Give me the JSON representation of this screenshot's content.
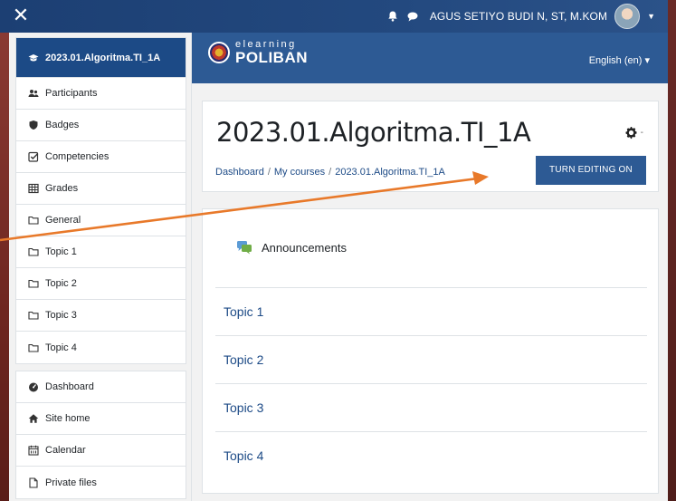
{
  "navbar": {
    "close_glyph": "✕",
    "user_name": "AGUS SETIYO BUDI N, ST, M.KOM",
    "icons": [
      "bell-icon",
      "chat-icon",
      "avatar",
      "caret-down-icon"
    ]
  },
  "header": {
    "logo_top": "elearning",
    "logo_bottom": "POLIBAN",
    "language": "English (en) ▾"
  },
  "sidebar": {
    "course_items": [
      {
        "label": "2023.01.Algoritma.TI_1A",
        "icon": "graduation-cap-icon",
        "active": true
      },
      {
        "label": "Participants",
        "icon": "users-icon"
      },
      {
        "label": "Badges",
        "icon": "shield-icon"
      },
      {
        "label": "Competencies",
        "icon": "check-square-icon"
      },
      {
        "label": "Grades",
        "icon": "table-icon"
      },
      {
        "label": "General",
        "icon": "folder-icon"
      },
      {
        "label": "Topic 1",
        "icon": "folder-icon"
      },
      {
        "label": "Topic 2",
        "icon": "folder-icon"
      },
      {
        "label": "Topic 3",
        "icon": "folder-icon"
      },
      {
        "label": "Topic 4",
        "icon": "folder-icon"
      }
    ],
    "site_items": [
      {
        "label": "Dashboard",
        "icon": "dashboard-icon"
      },
      {
        "label": "Site home",
        "icon": "home-icon"
      },
      {
        "label": "Calendar",
        "icon": "calendar-icon"
      },
      {
        "label": "Private files",
        "icon": "file-icon"
      }
    ]
  },
  "page": {
    "course_title": "2023.01.Algoritma.TI_1A",
    "breadcrumb": [
      "Dashboard",
      "My courses",
      "2023.01.Algoritma.TI_1A"
    ],
    "breadcrumb_sep": "/",
    "edit_button": "TURN EDITING ON",
    "announcements": "Announcements",
    "topics": [
      "Topic 1",
      "Topic 2",
      "Topic 3",
      "Topic 4"
    ]
  },
  "colors": {
    "navbar": "#1c3f73",
    "primary": "#2d5a94",
    "link": "#1c4a86",
    "arrow": "#e8792a"
  }
}
